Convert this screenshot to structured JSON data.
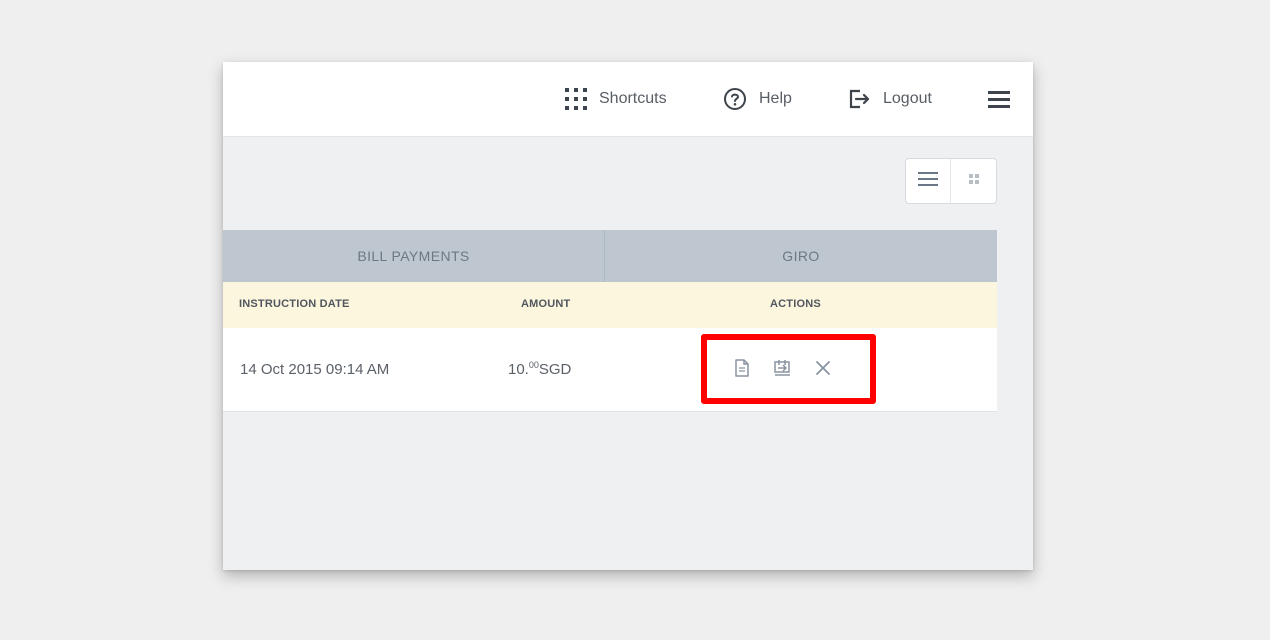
{
  "topbar": {
    "shortcuts": {
      "label": "Shortcuts",
      "icon": "grid-icon"
    },
    "help": {
      "label": "Help",
      "icon": "question-circle-icon"
    },
    "logout": {
      "label": "Logout",
      "icon": "logout-icon"
    },
    "menu": {
      "icon": "hamburger-menu-icon"
    }
  },
  "view_toggle": {
    "options": [
      "list-view-icon",
      "grid-view-icon"
    ],
    "selected": "list-view-icon"
  },
  "tabs": [
    {
      "label": "BILL PAYMENTS"
    },
    {
      "label": "GIRO"
    }
  ],
  "table": {
    "columns": [
      "INSTRUCTION DATE",
      "AMOUNT",
      "ACTIONS"
    ],
    "rows": [
      {
        "date": "14 Oct 2015 09:14 AM",
        "amount_whole": "10.",
        "amount_decimal": "00",
        "currency": "SGD",
        "actions": [
          "view-document-icon",
          "repeat-payment-icon",
          "cancel-icon"
        ]
      }
    ]
  },
  "colors": {
    "highlight": "#ff0000",
    "tab_bar": "#bec7cf",
    "header_row": "#fdf6df"
  }
}
